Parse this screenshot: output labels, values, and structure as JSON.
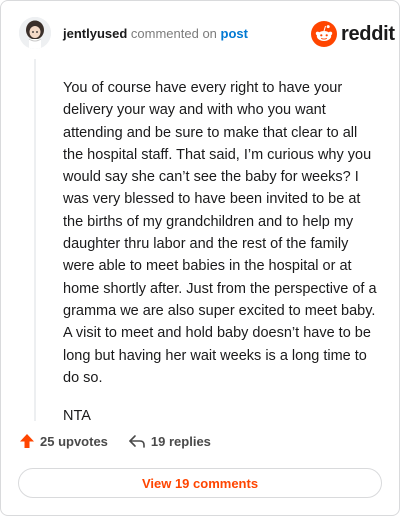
{
  "header": {
    "username": "jentlyused",
    "commented_on": "commented on",
    "post_link": "post",
    "brand": "reddit"
  },
  "comment": {
    "paragraphs": [
      "You of course have every right to have your delivery your way and with who you want attending and be sure to make that clear to all the hospital staff. That said, I’m curious why you would say she can’t see the baby for weeks? I was very blessed to have been invited to be at the births of my grandchildren and to help my daughter thru labor and the rest of the family were able to meet babies in the hospital or at home shortly after. Just from the perspective of a gramma we are also super excited to meet baby. A visit to meet and hold baby doesn’t have to be long but having her wait weeks is a long time to do so.",
      "NTA"
    ]
  },
  "actions": {
    "upvotes": "25 upvotes",
    "replies": "19 replies",
    "view_comments": "View 19 comments"
  },
  "colors": {
    "accent": "#ff4500",
    "link": "#0079d3"
  },
  "icons": {
    "avatar": "avatar-icon",
    "logo": "reddit-logo-icon",
    "upvote": "upvote-arrow-icon",
    "reply": "reply-arrow-icon"
  }
}
